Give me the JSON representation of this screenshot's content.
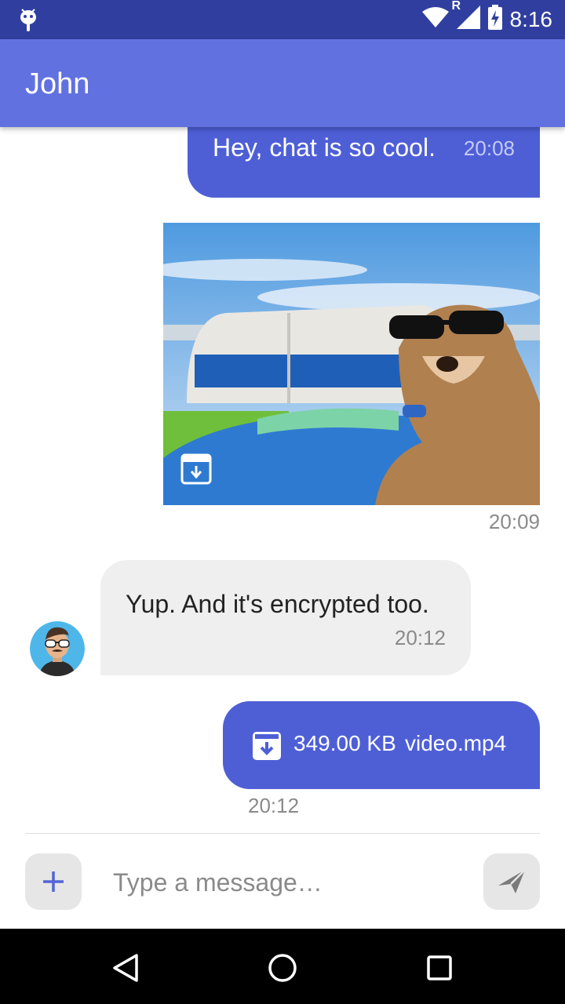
{
  "status_bar": {
    "time": "8:16",
    "network_label": "R",
    "icons": [
      "android-debug-icon",
      "wifi-icon",
      "signal-icon",
      "battery-charging-icon"
    ]
  },
  "header": {
    "title": "John"
  },
  "messages": [
    {
      "direction": "outgoing",
      "type": "text",
      "text": "Hey, chat is so cool.",
      "time": "20:08"
    },
    {
      "direction": "outgoing",
      "type": "image",
      "image_subject": "dog wearing sunglasses on a boat",
      "time": "20:09"
    },
    {
      "direction": "incoming",
      "type": "text",
      "text": "Yup. And it's encrypted too.",
      "time": "20:12"
    },
    {
      "direction": "outgoing",
      "type": "file",
      "file_size": "349.00 KB",
      "file_name": "video.mp4",
      "time": "20:12"
    }
  ],
  "composer": {
    "placeholder": "Type a message…",
    "value": ""
  },
  "colors": {
    "status_bar": "#303f9f",
    "app_bar": "#6171e0",
    "outgoing_bubble": "#4e5fd6",
    "incoming_bubble": "#efefef",
    "accent": "#5364d6"
  }
}
